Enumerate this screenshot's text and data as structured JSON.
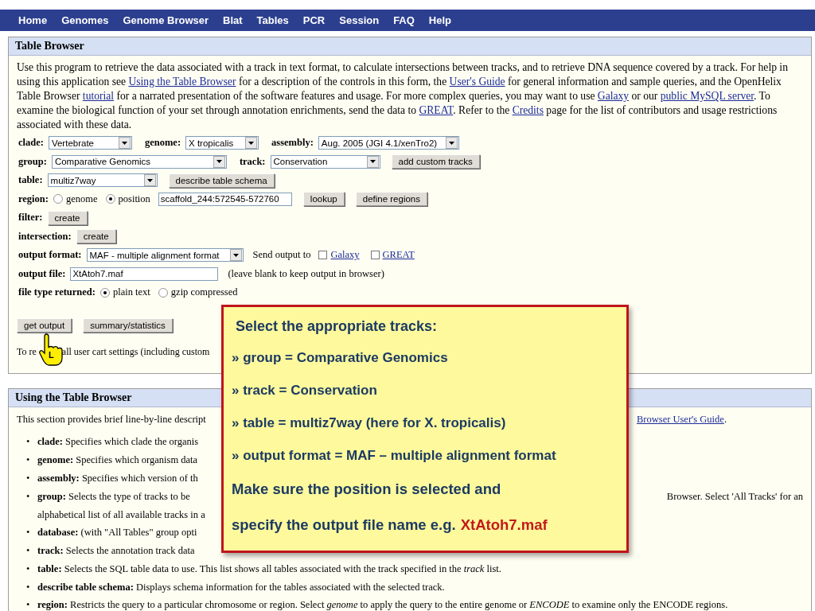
{
  "nav": [
    "Home",
    "Genomes",
    "Genome Browser",
    "Blat",
    "Tables",
    "PCR",
    "Session",
    "FAQ",
    "Help"
  ],
  "table_browser": {
    "title": "Table Browser",
    "intro": [
      {
        "text": "Use this program to retrieve the data associated with a track in text format, to calculate intersections between tracks, and to retrieve DNA sequence covered by a track. For help in using this application see ",
        "link": false
      },
      {
        "text": "Using the Table Browser",
        "link": true
      },
      {
        "text": " for a description of the controls in this form, the ",
        "link": false
      },
      {
        "text": "User's Guide",
        "link": true
      },
      {
        "text": " for general information and sample queries, and the OpenHelix Table Browser ",
        "link": false
      },
      {
        "text": "tutorial",
        "link": true
      },
      {
        "text": " for a narrated presentation of the software features and usage. For more complex queries, you may want to use ",
        "link": false
      },
      {
        "text": "Galaxy",
        "link": true
      },
      {
        "text": " or our ",
        "link": false
      },
      {
        "text": "public MySQL server",
        "link": true
      },
      {
        "text": ". To examine the biological function of your set through annotation enrichments, send the data to ",
        "link": false
      },
      {
        "text": "GREAT",
        "link": true
      },
      {
        "text": ". Refer to the ",
        "link": false
      },
      {
        "text": "Credits",
        "link": true
      },
      {
        "text": " page for the list of contributors and usage restrictions associated with these data.",
        "link": false
      }
    ],
    "form_lines": [
      {
        "fields": [
          {
            "kind": "label",
            "text": "clade:"
          },
          {
            "kind": "select",
            "value": "Vertebrate"
          },
          {
            "kind": "label",
            "text": "genome:"
          },
          {
            "kind": "select",
            "value": "X tropicalis"
          },
          {
            "kind": "label",
            "text": "assembly:"
          },
          {
            "kind": "select",
            "value": "Aug. 2005 (JGI 4.1/xenTro2)"
          }
        ]
      },
      {
        "fields": [
          {
            "kind": "label",
            "text": "group:"
          },
          {
            "kind": "select",
            "value": "Comparative Genomics"
          },
          {
            "kind": "label",
            "text": "track:"
          },
          {
            "kind": "select",
            "value": "Conservation"
          },
          {
            "kind": "button",
            "text": "add custom tracks"
          }
        ]
      },
      {
        "fields": [
          {
            "kind": "label",
            "text": "table:"
          },
          {
            "kind": "select",
            "value": "multiz7way"
          },
          {
            "kind": "button",
            "text": "describe table schema"
          }
        ]
      },
      {
        "fields": [
          {
            "kind": "label",
            "text": "region:"
          },
          {
            "kind": "radio",
            "text": "genome",
            "selected": false
          },
          {
            "kind": "radio",
            "text": "position",
            "selected": true
          },
          {
            "kind": "input",
            "value": "scaffold_244:572545-572760"
          },
          {
            "kind": "button",
            "text": "lookup"
          },
          {
            "kind": "button",
            "text": "define regions"
          }
        ]
      },
      {
        "fields": [
          {
            "kind": "label",
            "text": "filter:"
          },
          {
            "kind": "button",
            "text": "create"
          }
        ]
      },
      {
        "fields": [
          {
            "kind": "label",
            "text": "intersection:"
          },
          {
            "kind": "button",
            "text": "create"
          }
        ]
      },
      {
        "fields": [
          {
            "kind": "label",
            "text": "output format:"
          },
          {
            "kind": "select",
            "value": "MAF - multiple alignment format"
          },
          {
            "kind": "text",
            "text": "Send output to"
          },
          {
            "kind": "checkbox",
            "text": "Galaxy",
            "checked": false
          },
          {
            "kind": "checkbox",
            "text": "GREAT",
            "checked": false
          }
        ]
      },
      {
        "fields": [
          {
            "kind": "label",
            "text": "output file:"
          },
          {
            "kind": "input",
            "value": "XtAtoh7.maf"
          },
          {
            "kind": "text",
            "text": "(leave blank to keep output in browser)"
          }
        ]
      },
      {
        "fields": [
          {
            "kind": "label",
            "text": "file type returned:"
          },
          {
            "kind": "radio",
            "text": "plain text",
            "selected": true
          },
          {
            "kind": "radio",
            "text": "gzip compressed",
            "selected": false
          }
        ]
      }
    ],
    "actions": [
      "get output",
      "summary/statistics"
    ],
    "reset_before": "To re",
    "reset_after": "all user cart settings (including custom"
  },
  "cursor_badge": "L",
  "using": {
    "title": "Using the Table Browser",
    "intro_left": "This section provides brief line-by-line descript",
    "intro_link": "Browser User's Guide",
    "intro_end": ".",
    "items": [
      {
        "marker": "•",
        "term": "clade:",
        "left": "Specifies which clade the organis"
      },
      {
        "marker": "•",
        "term": "genome:",
        "left": "Specifies which organism data"
      },
      {
        "marker": "•",
        "term": "assembly:",
        "left": "Specifies which version of th"
      },
      {
        "marker": "•",
        "term": "group:",
        "left": "Selects the type of tracks to be",
        "right": "Browser. Select 'All Tracks' for an",
        "cont": "alphabetical list of all available tracks in a"
      },
      {
        "marker": "•",
        "term": "database:",
        "left": "(with \"All Tables\" group opti"
      },
      {
        "marker": "•",
        "term": "track:",
        "left": "Selects the annotation track data"
      },
      {
        "marker": "•",
        "term": "table:",
        "text": "Selects the SQL table data to use. This list shows all tables associated with the track specified in the *track* list."
      },
      {
        "marker": "•",
        "term": "describe table schema:",
        "text": "Displays schema information for the tables associated with the selected track."
      },
      {
        "marker": "•",
        "term": "region:",
        "text": "Restricts the query to a particular chromosome or region. Select *genome* to apply the query to the entire genome or *ENCODE* to examine only the ENCODE regions."
      }
    ]
  },
  "callout": {
    "heading": "Select the appropriate tracks:",
    "lines": [
      {
        "kind": "bullet",
        "text": "» group = Comparative Genomics"
      },
      {
        "kind": "bullet",
        "text": "» track = Conservation"
      },
      {
        "kind": "bullet",
        "text": "» table = multiz7way (here for X. tropicalis)"
      },
      {
        "kind": "bullet",
        "text": "» output format = MAF – multiple alignment format"
      },
      {
        "kind": "note",
        "parts": [
          {
            "text": "Make sure the position is selected and",
            "highlight": false
          }
        ]
      },
      {
        "kind": "note",
        "parts": [
          {
            "text": "specify the output file name e.g.",
            "highlight": false
          },
          {
            "text": "XtAtoh7.maf",
            "highlight": true
          }
        ]
      }
    ]
  }
}
